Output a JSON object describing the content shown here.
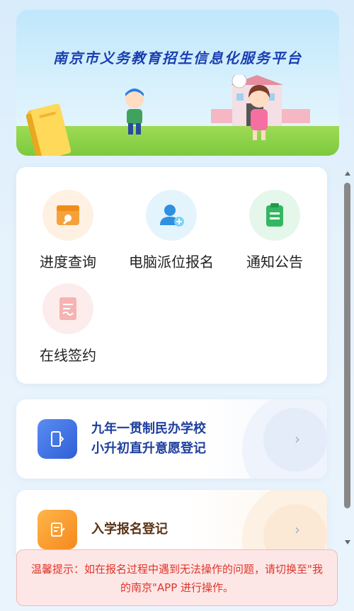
{
  "banner": {
    "title": "南京市义务教育招生信息化服务平台"
  },
  "services": [
    {
      "label": "进度查询",
      "icon": "progress-query-icon",
      "bg": "#fef1e2",
      "color": "#f5a23b"
    },
    {
      "label": "电脑派位报名",
      "icon": "user-register-icon",
      "bg": "#e4f4fc",
      "color": "#2f8fe0"
    },
    {
      "label": "通知公告",
      "icon": "notice-icon",
      "bg": "#e4f7ea",
      "color": "#34b761"
    },
    {
      "label": "在线签约",
      "icon": "sign-icon",
      "bg": "#fdecec",
      "color": "#f2a3a3"
    }
  ],
  "entries": [
    {
      "line1": "九年一贯制民办学校",
      "line2": "小升初直升意愿登记",
      "color": "#1f3f9c"
    },
    {
      "line1": "入学报名登记",
      "color": "#5a3415"
    }
  ],
  "notice": {
    "text": "温馨提示：如在报名过程中遇到无法操作的问题，请切换至\"我的南京\"APP 进行操作。"
  },
  "colors": {
    "accent_blue": "#3b6fe6",
    "accent_orange": "#f5a23b",
    "notice_red": "#e0352b"
  }
}
